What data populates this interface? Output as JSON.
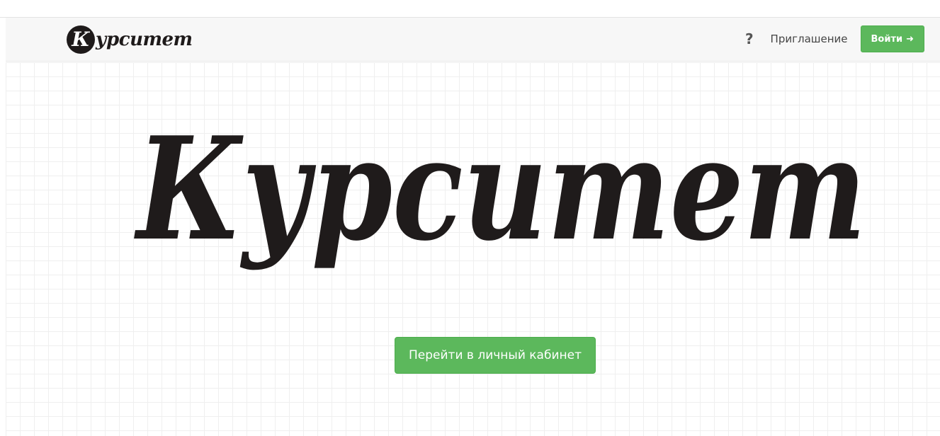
{
  "brand": {
    "text": "Курситет",
    "mark_letter": "К",
    "word_rest": "урситет"
  },
  "nav": {
    "help_icon": "question-mark-icon",
    "help_glyph": "?",
    "invite_label": "Приглашение",
    "login_label": "Войти",
    "login_icon": "sign-in-icon",
    "login_glyph": "➜"
  },
  "hero": {
    "logo_text": "Курситет"
  },
  "cta": {
    "label": "Перейти в личный кабинет"
  },
  "colors": {
    "accent_green": "#5cb85c",
    "logo_ink": "#1f1b1b",
    "navbar_bg": "#f7f7f7",
    "grid_line": "#efefef"
  }
}
